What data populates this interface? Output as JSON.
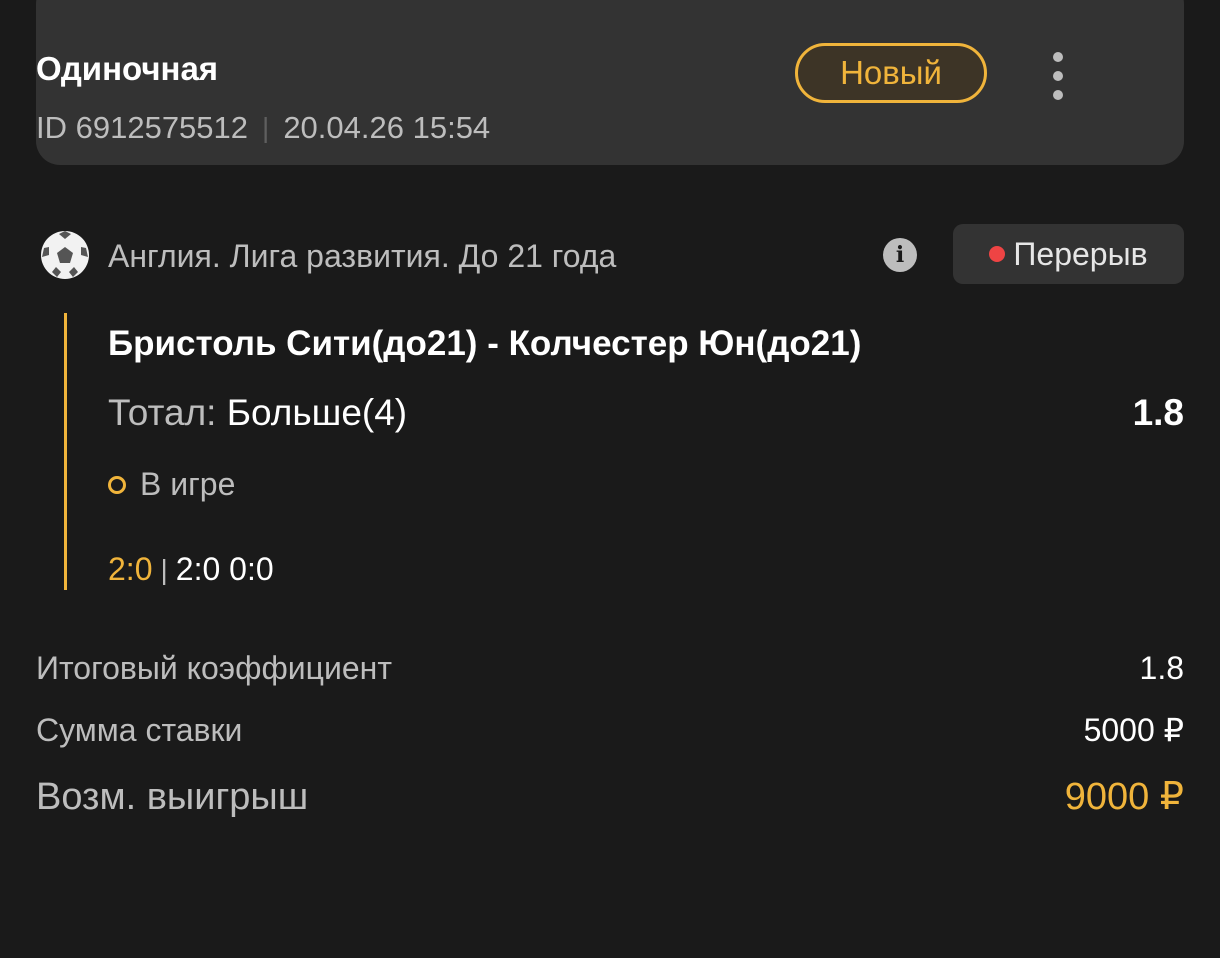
{
  "header": {
    "bet_type": "Одиночная",
    "bet_id": "ID 6912575512",
    "separator": "|",
    "datetime": "20.04.26 15:54",
    "status": "Новый",
    "menu_icon": "more-vertical-icon"
  },
  "league": {
    "sport_icon": "soccer-ball-icon",
    "name": "Англия. Лига развития. До 21 года",
    "info_icon": "i",
    "period": "Перерыв"
  },
  "event": {
    "teams": "Бристоль Сити(до21) - Колчестер Юн(до21)",
    "market_label": "Тотал:",
    "market_value": "Больше(4)",
    "odds": "1.8",
    "state": "В игре",
    "score_main": "2:0",
    "score_sep": "|",
    "score_periods": "2:0 0:0"
  },
  "summary": {
    "total_odds_label": "Итоговый коэффициент",
    "total_odds": "1.8",
    "stake_label": "Сумма ставки",
    "stake": "5000 ₽",
    "win_label": "Возм. выигрыш",
    "win": "9000 ₽"
  },
  "colors": {
    "background": "#1a1a1a",
    "card": "#333333",
    "accent": "#f0b43b",
    "live_dot": "#ee4444",
    "muted_text": "#bdbdbd"
  }
}
